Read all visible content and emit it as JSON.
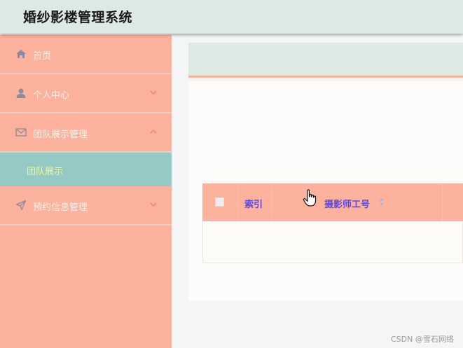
{
  "header": {
    "title": "婚纱影楼管理系统"
  },
  "sidebar": {
    "items": [
      {
        "label": "首页",
        "icon": "home-icon"
      },
      {
        "label": "个人中心",
        "icon": "user-icon",
        "chevron": "chevron-down-icon"
      },
      {
        "label": "团队展示管理",
        "icon": "mail-icon",
        "chevron": "chevron-up-icon",
        "submenu": [
          {
            "label": "团队展示",
            "active": true
          }
        ]
      },
      {
        "label": "预约信息管理",
        "icon": "send-icon",
        "chevron": "chevron-down-icon"
      }
    ]
  },
  "table": {
    "columns": [
      {
        "key": "select",
        "label": ""
      },
      {
        "key": "index",
        "label": "索引"
      },
      {
        "key": "photographer_id",
        "label": "摄影师工号",
        "sortable": true
      }
    ],
    "rows": []
  },
  "watermark": "CSDN @雪石网络",
  "colors": {
    "header_bg": "#dde9e3",
    "sidebar_bg": "#fdb29d",
    "submenu_active_bg": "#95c9c4",
    "submenu_active_text": "#f2f88a",
    "table_header_text": "#5e48d4"
  }
}
